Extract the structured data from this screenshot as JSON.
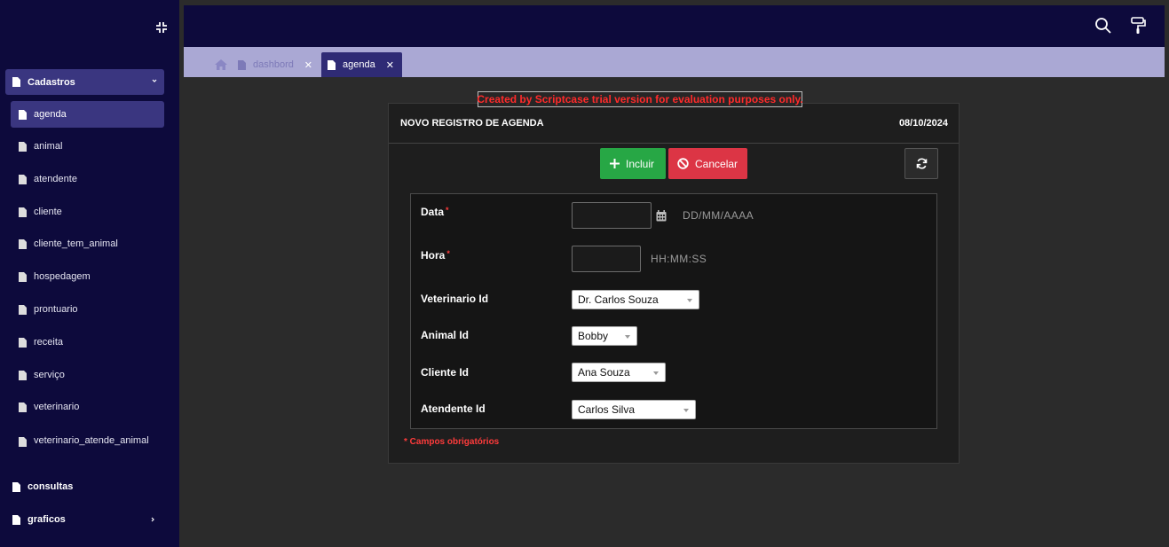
{
  "sidebar": {
    "group_label": "Cadastros",
    "items": [
      {
        "label": "agenda",
        "active": true
      },
      {
        "label": "animal"
      },
      {
        "label": "atendente"
      },
      {
        "label": "cliente"
      },
      {
        "label": "cliente_tem_animal"
      },
      {
        "label": "hospedagem"
      },
      {
        "label": "prontuario"
      },
      {
        "label": "receita"
      },
      {
        "label": "serviço"
      },
      {
        "label": "veterinario"
      },
      {
        "label": "veterinario_atende_animal"
      }
    ],
    "consultas_label": "consultas",
    "graficos_label": "graficos"
  },
  "tabs": [
    {
      "label": "dashbord",
      "active": false
    },
    {
      "label": "agenda",
      "active": true
    }
  ],
  "icons": {
    "collapse": "compress-icon",
    "search": "search-icon",
    "theme": "paint-roller-icon",
    "home": "home-icon",
    "document": "file-icon",
    "calendar": "calendar-icon",
    "refresh": "refresh-icon"
  },
  "trial_banner": "Created by Scriptcase trial version for evaluation purposes only.",
  "form": {
    "title": "NOVO REGISTRO DE AGENDA",
    "date": "08/10/2024",
    "incluir_label": "Incluir",
    "cancelar_label": "Cancelar",
    "fields": {
      "data": {
        "label": "Data",
        "required": "*",
        "value": "",
        "hint": "DD/MM/AAAA"
      },
      "hora": {
        "label": "Hora",
        "required": "*",
        "value": "",
        "hint": "HH:MM:SS"
      },
      "veterinario": {
        "label": "Veterinario Id",
        "value": "Dr. Carlos Souza"
      },
      "animal": {
        "label": "Animal Id",
        "value": "Bobby"
      },
      "cliente": {
        "label": "Cliente Id",
        "value": "Ana Souza"
      },
      "atendente": {
        "label": "Atendente Id",
        "value": "Carlos Silva"
      }
    },
    "required_note": "* Campos obrigatórios"
  },
  "colors": {
    "sidebar_bg": "#0d0a3c",
    "active_item": "#3a3680",
    "tabbar_bg": "#aaa8d4",
    "incluir": "#27a745",
    "cancelar": "#dc3545",
    "required": "#ff3b3b"
  }
}
